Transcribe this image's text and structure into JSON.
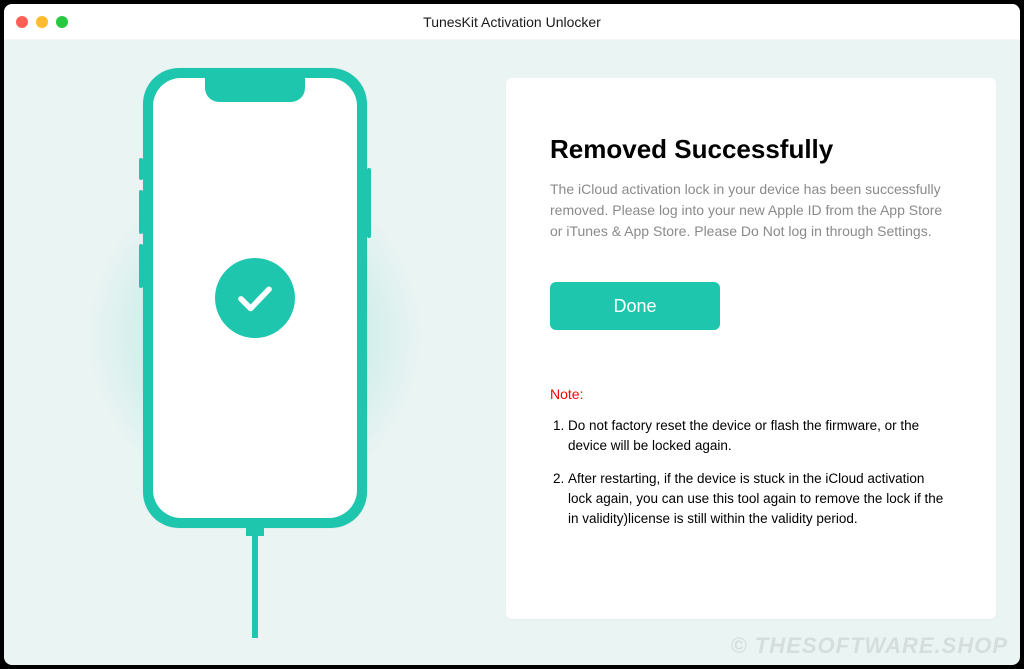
{
  "window": {
    "title": "TunesKit Activation Unlocker"
  },
  "main": {
    "heading": "Removed Successfully",
    "description": "The iCloud activation lock in your device has been successfully removed. Please log into your new Apple ID from the App Store or iTunes & App Store. Please Do Not log in through Settings.",
    "done_label": "Done",
    "note_label": "Note:",
    "notes": [
      "Do not factory reset the device or flash the firmware, or the device will be locked again.",
      "After restarting, if the device is stuck in the iCloud activation lock again, you can use this tool again to remove the lock if the in validity)license is still within the validity period."
    ]
  },
  "watermark": "© THESOFTWARE.SHOP",
  "colors": {
    "accent": "#1fc6ae",
    "background": "#eaf4f3",
    "note_color": "#ff0000"
  },
  "icons": {
    "success": "checkmark-icon",
    "device": "phone-icon"
  }
}
